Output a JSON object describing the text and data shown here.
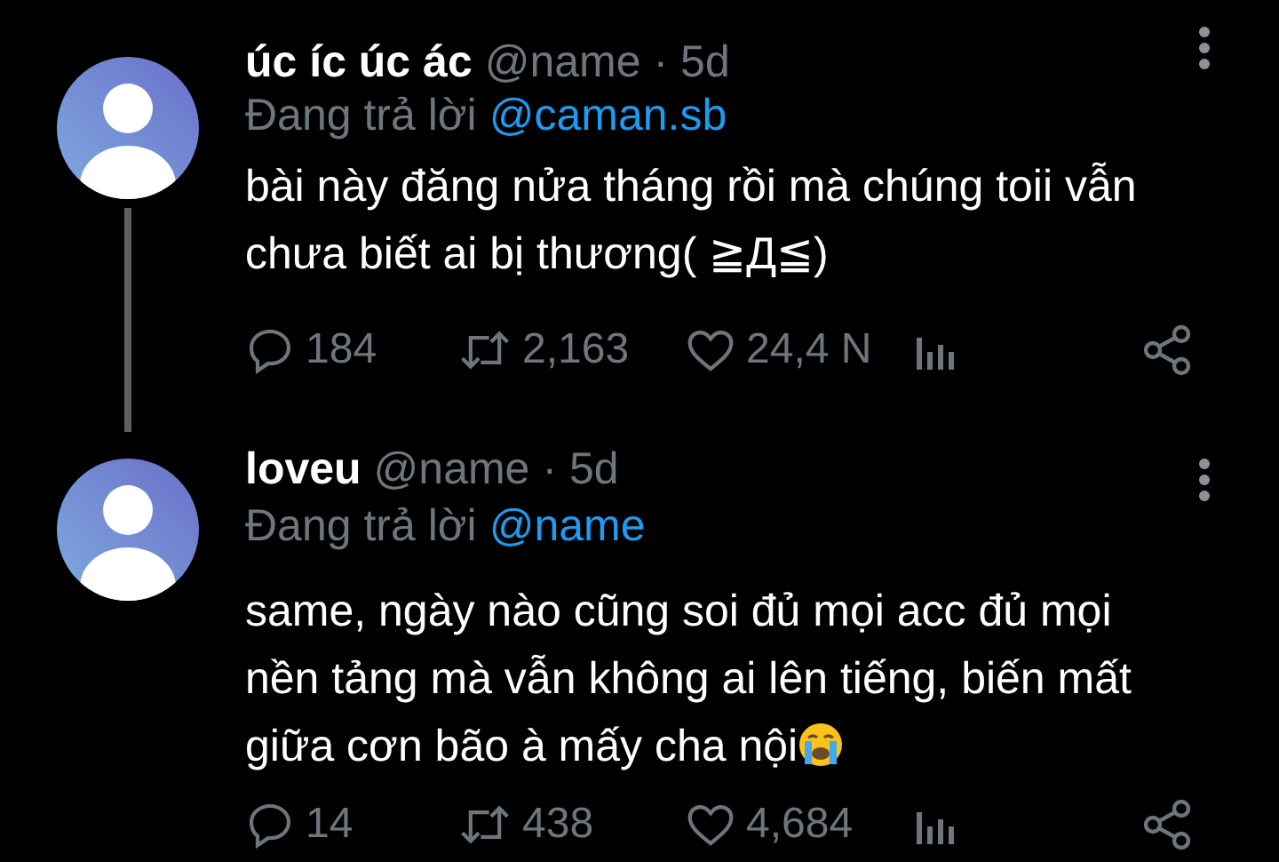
{
  "tweets": [
    {
      "display_name": "úc íc úc ác",
      "handle": "@name",
      "time": "· 5d",
      "reply_label": "Đang trả lời",
      "reply_to": "@caman.sb",
      "text": "bài này đăng nửa tháng rồi mà chúng toii vẫn chưa biết ai bị thương( ≧Д≦)",
      "emoji": false,
      "thread_line": true,
      "replies": "184",
      "retweets": "2,163",
      "likes": "24,4 N"
    },
    {
      "display_name": "loveu",
      "handle": "@name",
      "time": "· 5d",
      "reply_label": "Đang trả lời",
      "reply_to": "@name",
      "text": "same, ngày nào cũng soi đủ mọi acc đủ mọi nền tảng mà vẫn không ai lên tiếng, biến mất giữa cơn bão à mấy cha nội",
      "emoji": true,
      "thread_line": false,
      "replies": "14",
      "retweets": "438",
      "likes": "4,684"
    }
  ]
}
